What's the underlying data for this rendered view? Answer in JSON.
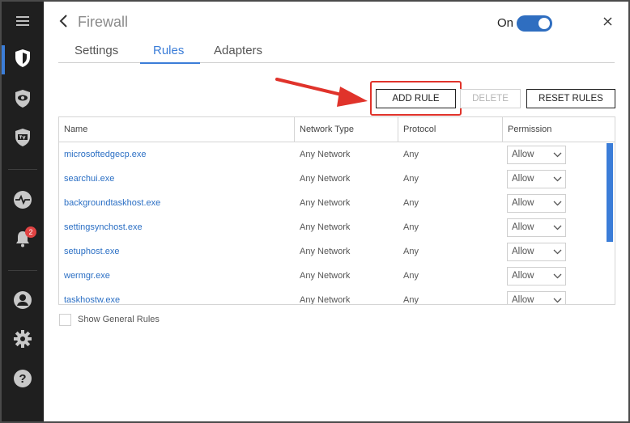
{
  "window": {
    "title": "Firewall"
  },
  "toggle": {
    "label": "On",
    "state": "on",
    "color": "#2f6ec0"
  },
  "tabs": [
    {
      "label": "Settings",
      "active": false
    },
    {
      "label": "Rules",
      "active": true
    },
    {
      "label": "Adapters",
      "active": false
    }
  ],
  "actions": {
    "add_rule": "ADD RULE",
    "delete": "DELETE",
    "reset_rules": "RESET RULES"
  },
  "sidebar": {
    "items": [
      {
        "icon": "menu-icon"
      },
      {
        "icon": "shield-icon",
        "active": true
      },
      {
        "icon": "eye-shield-icon"
      },
      {
        "icon": "tv-shield-icon"
      },
      {
        "icon": "activity-icon"
      },
      {
        "icon": "bell-icon",
        "badge": "2"
      },
      {
        "icon": "user-icon"
      },
      {
        "icon": "gear-icon"
      },
      {
        "icon": "help-icon"
      }
    ]
  },
  "table": {
    "columns": [
      "Name",
      "Network Type",
      "Protocol",
      "Permission"
    ],
    "rows": [
      {
        "name": "microsoftedgecp.exe",
        "network": "Any Network",
        "protocol": "Any",
        "permission": "Allow"
      },
      {
        "name": "searchui.exe",
        "network": "Any Network",
        "protocol": "Any",
        "permission": "Allow"
      },
      {
        "name": "backgroundtaskhost.exe",
        "network": "Any Network",
        "protocol": "Any",
        "permission": "Allow"
      },
      {
        "name": "settingsynchost.exe",
        "network": "Any Network",
        "protocol": "Any",
        "permission": "Allow"
      },
      {
        "name": "setuphost.exe",
        "network": "Any Network",
        "protocol": "Any",
        "permission": "Allow"
      },
      {
        "name": "wermgr.exe",
        "network": "Any Network",
        "protocol": "Any",
        "permission": "Allow"
      },
      {
        "name": "taskhostw.exe",
        "network": "Any Network",
        "protocol": "Any",
        "permission": "Allow"
      }
    ]
  },
  "show_general_rules": {
    "label": "Show General Rules",
    "checked": false
  },
  "colors": {
    "accent": "#3b7dd8",
    "highlight": "#e0332b",
    "sidebar": "#1f1f1f"
  }
}
